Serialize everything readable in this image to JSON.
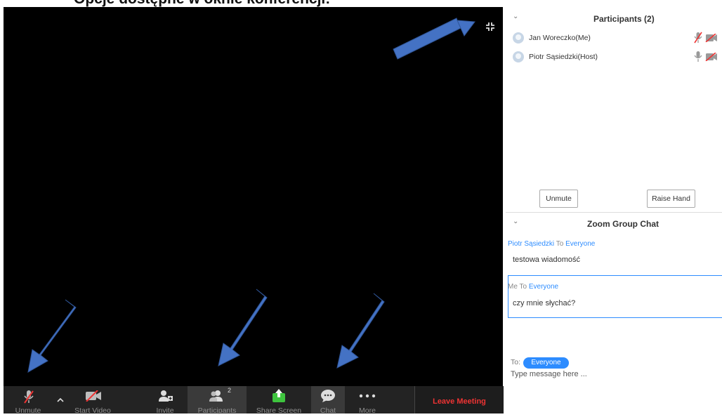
{
  "caption": "Opcje dostępne w oknie konferencji:",
  "toolbar": {
    "unmute": "Unmute",
    "start_video": "Start Video",
    "invite": "Invite",
    "participants": "Participants",
    "participants_count": "2",
    "share_screen": "Share Screen",
    "chat": "Chat",
    "more": "More",
    "leave": "Leave Meeting"
  },
  "participants_panel": {
    "title": "Participants (2)",
    "list": [
      {
        "name": "Jan Woreczko(Me)",
        "mic_muted": true,
        "video_off": true
      },
      {
        "name": "Piotr Sąsiedzki(Host)",
        "mic_muted": false,
        "video_off": true
      }
    ],
    "unmute_button": "Unmute",
    "raise_hand_button": "Raise Hand"
  },
  "chat_panel": {
    "title": "Zoom Group Chat",
    "messages": [
      {
        "sender": "Piotr Sąsiedzki",
        "to_word": "To",
        "recipient": "Everyone",
        "text": "testowa wiadomość"
      },
      {
        "sender": "Me",
        "to_word": "To",
        "recipient": "Everyone",
        "text": "czy mnie słychać?"
      }
    ],
    "to_label": "To:",
    "recipient_pill": "Everyone",
    "input_placeholder": "Type message here ..."
  },
  "colors": {
    "accent": "#2d8cff",
    "leave": "#e33333",
    "annotation_arrow": "#4472c4"
  },
  "icons": [
    "fullscreen-exit-icon",
    "mic-muted-icon",
    "chevron-up-icon",
    "video-off-icon",
    "invite-icon",
    "participants-icon",
    "share-screen-icon",
    "chat-icon",
    "more-icon"
  ]
}
